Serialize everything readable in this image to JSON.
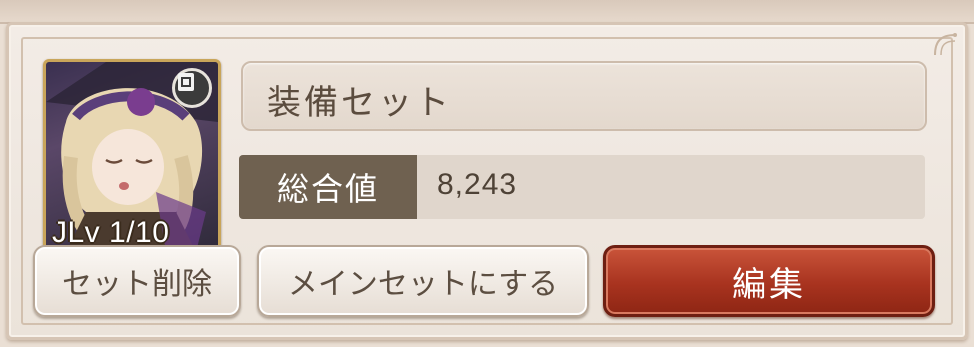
{
  "portrait": {
    "level_text": "JLv 1/10",
    "badge_icon": "equipment-card-icon"
  },
  "set": {
    "name": "装備セット"
  },
  "stats": {
    "label": "総合値",
    "value": "8,243"
  },
  "buttons": {
    "delete_label": "セット削除",
    "main_set_label": "メインセットにする",
    "edit_label": "編集"
  },
  "colors": {
    "panel_bg": "#f3ece6",
    "stat_label_bg": "#6f6150",
    "edit_button": "#a8331f",
    "portrait_frame": "#c9a55a"
  }
}
